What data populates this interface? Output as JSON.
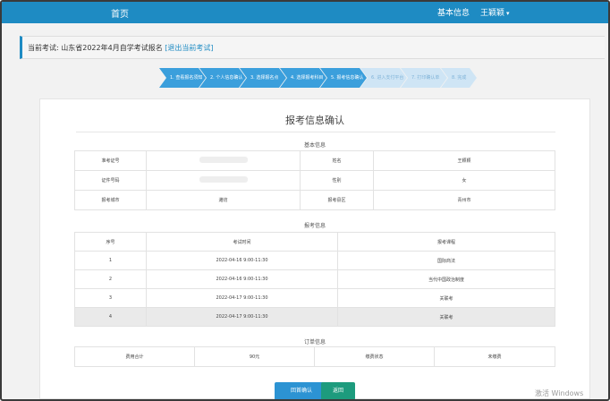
{
  "nav": {
    "home": "首页",
    "info": "基本信息",
    "user": "王颖颖",
    "caret": "▾"
  },
  "exam": {
    "label": "当前考试:",
    "name": "山东省2022年4月自学考试报名",
    "exit_link": "[退出当前考试]"
  },
  "steps": [
    {
      "label": "1. 查看报名须知",
      "state": "done"
    },
    {
      "label": "2. 个人信息确认",
      "state": "done"
    },
    {
      "label": "3. 选择报名点",
      "state": "done"
    },
    {
      "label": "4. 选择报考科目",
      "state": "done"
    },
    {
      "label": "5. 报考信息确认",
      "state": "done"
    },
    {
      "label": "6. 进入支付平台",
      "state": "todo"
    },
    {
      "label": "7. 打印确认单",
      "state": "todo"
    },
    {
      "label": "8. 完成",
      "state": "todo"
    }
  ],
  "page_title": "报考信息确认",
  "basic": {
    "section": "基本信息",
    "rows": [
      {
        "k1": "准考证号",
        "v1": "",
        "k2": "姓名",
        "v2": "王颖颖"
      },
      {
        "k1": "证件号码",
        "v1": "",
        "k2": "性别",
        "v2": "女"
      },
      {
        "k1": "报考城市",
        "v1": "潍坊",
        "k2": "报考县区",
        "v2": "青州市"
      }
    ]
  },
  "courses": {
    "section": "报考信息",
    "headers": [
      "序号",
      "考试时间",
      "报考课程"
    ],
    "rows": [
      {
        "no": "1",
        "time": "2022-04-16 9:00-11:30",
        "course": "国际商法"
      },
      {
        "no": "2",
        "time": "2022-04-16 9:00-11:30",
        "course": "当代中国政治制度"
      },
      {
        "no": "3",
        "time": "2022-04-17 9:00-11:30",
        "course": "关联考"
      },
      {
        "no": "4",
        "time": "2022-04-17 9:00-11:30",
        "course": "关联考"
      }
    ]
  },
  "order": {
    "section": "订单信息",
    "total_label": "费用合计",
    "total_value": "90元",
    "status_label": "缴费状态",
    "status_value": "未缴费"
  },
  "buttons": {
    "prev": "回首确认",
    "back": "返回"
  },
  "watermark": "激活 Windows"
}
